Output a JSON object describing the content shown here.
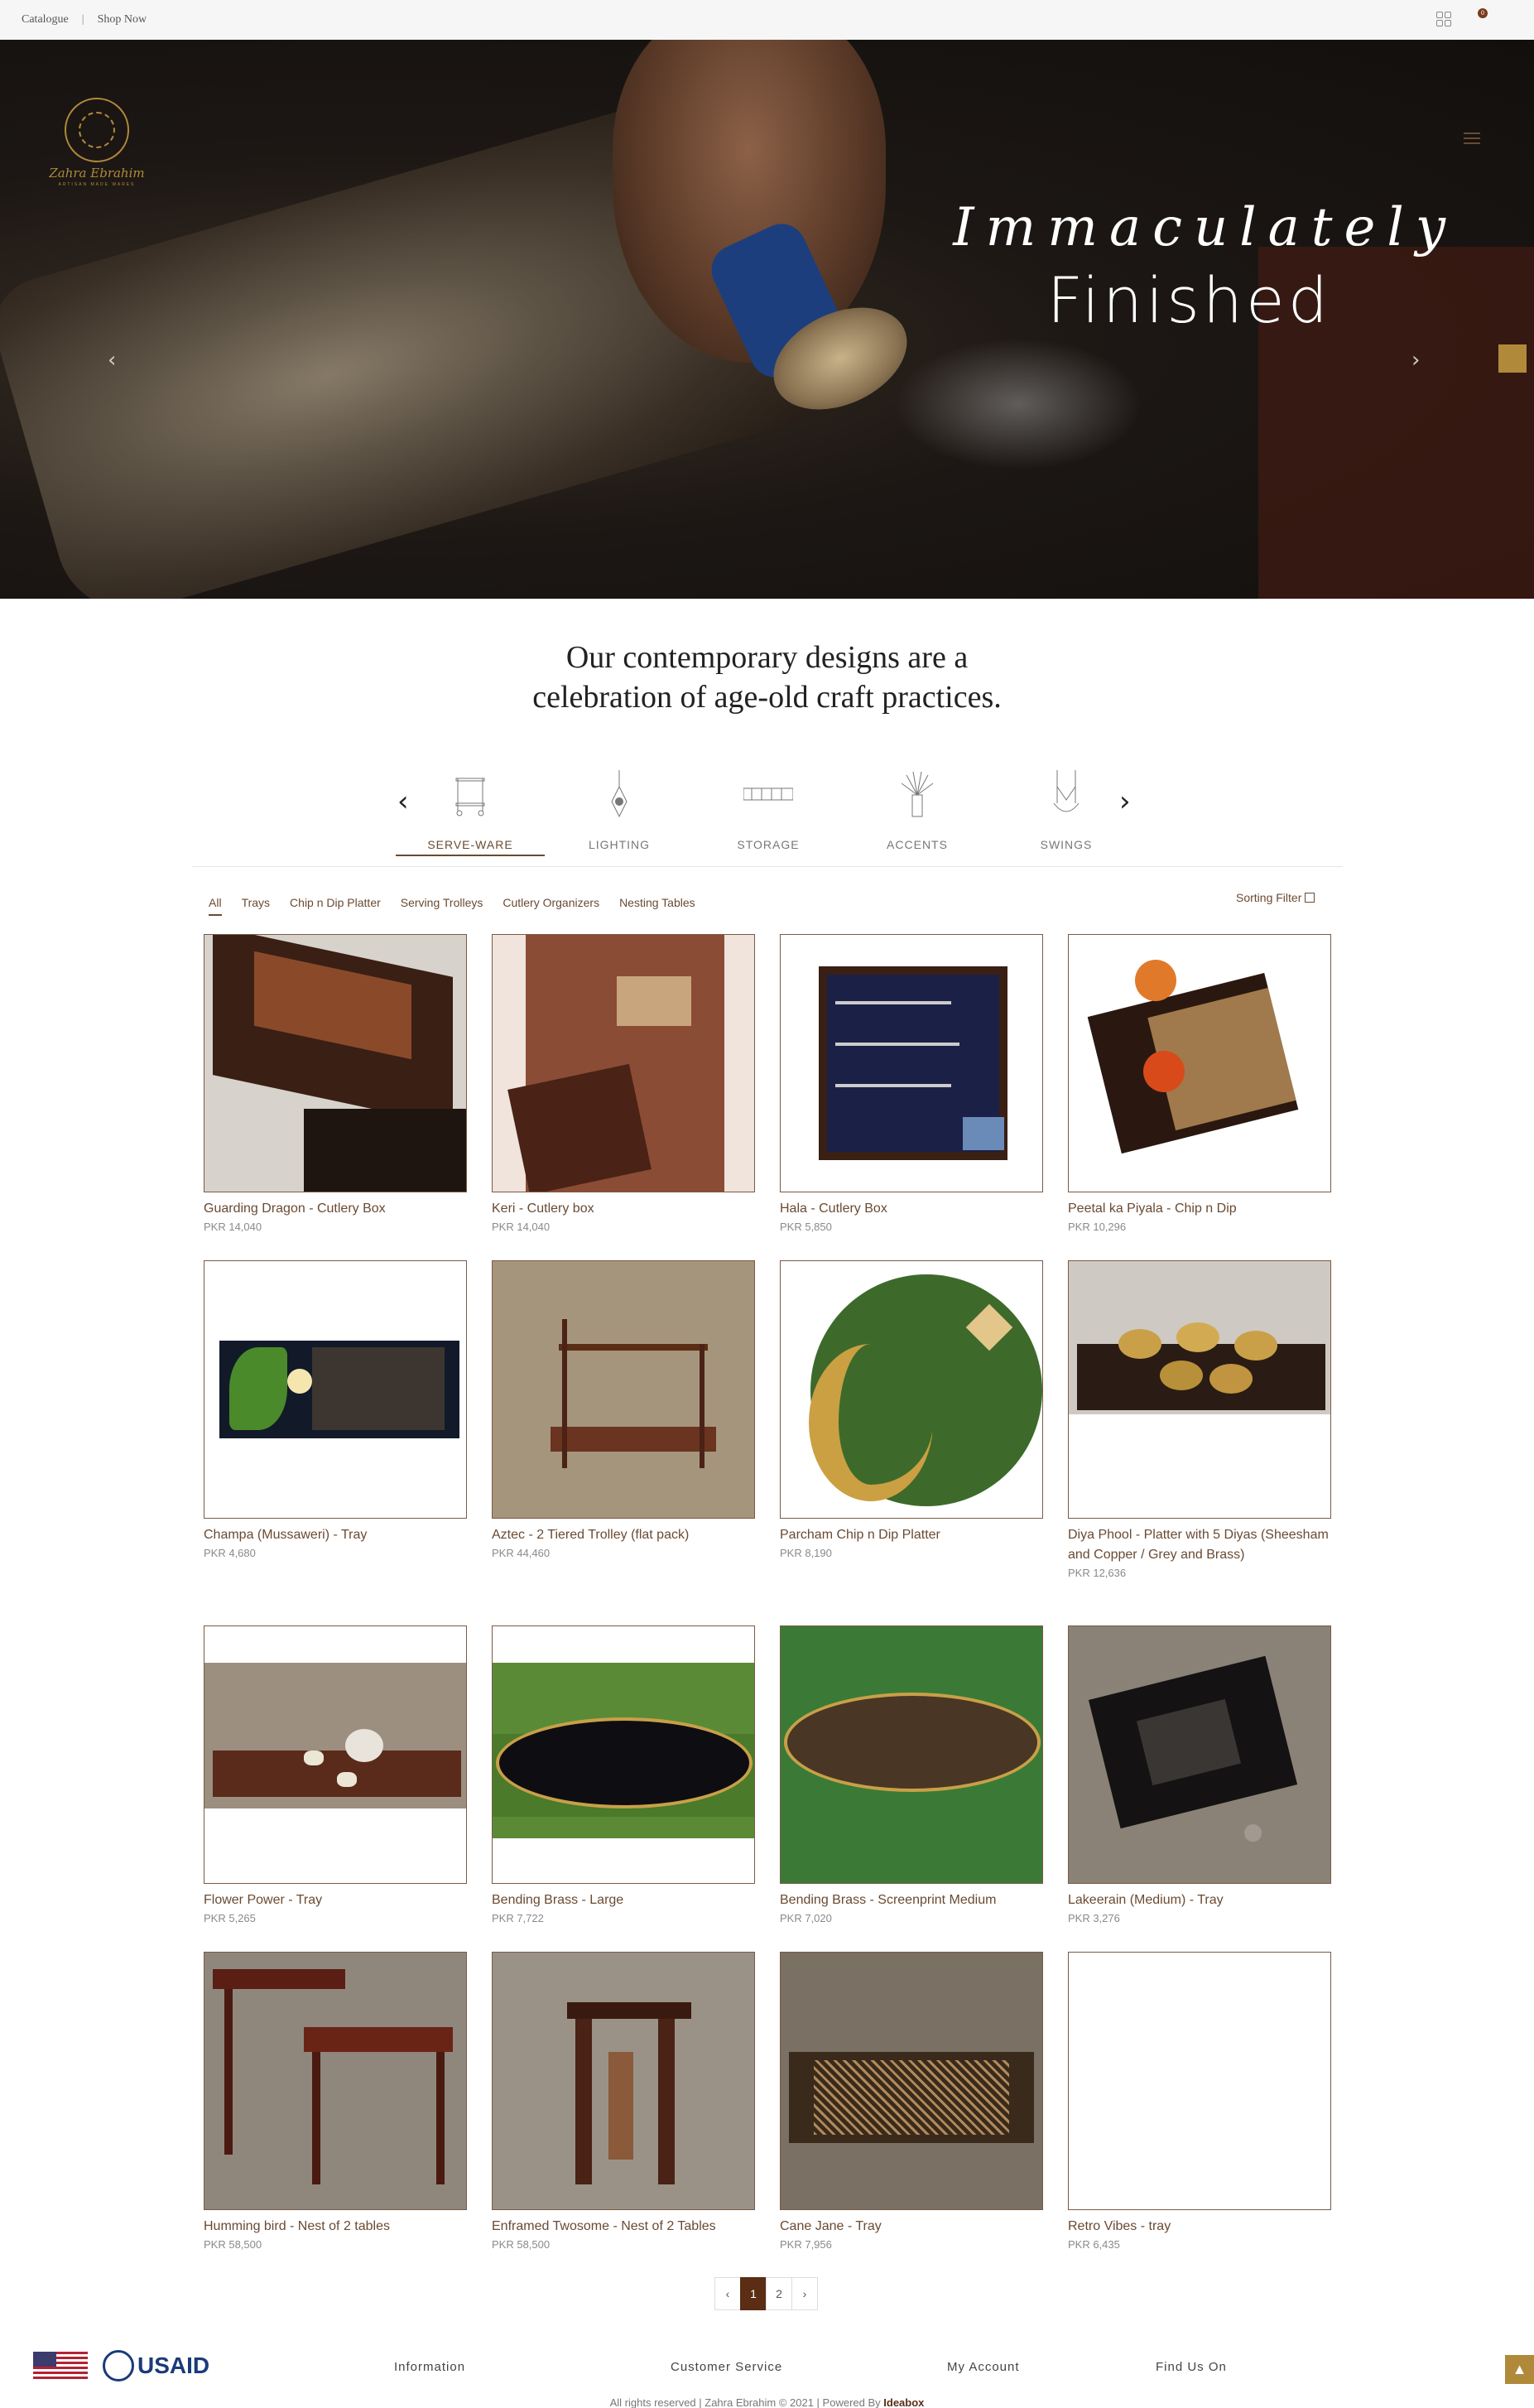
{
  "topbar": {
    "catalogue": "Catalogue",
    "shop_now": "Shop Now",
    "cart_count": "0"
  },
  "brand": {
    "name": "Zahra Ebrahim",
    "tagline": "ARTISAN MADE WARES"
  },
  "hero": {
    "script": "Immaculately",
    "title": "Finished",
    "slides": 4,
    "active_slide": 1
  },
  "intro": {
    "line1": "Our contemporary designs are a",
    "line2": "celebration of age-old craft practices."
  },
  "categories": [
    {
      "label": "SERVE-WARE",
      "icon": "trolley-icon"
    },
    {
      "label": "LIGHTING",
      "icon": "lamp-icon"
    },
    {
      "label": "STORAGE",
      "icon": "storage-icon"
    },
    {
      "label": "ACCENTS",
      "icon": "plant-icon"
    },
    {
      "label": "SWINGS",
      "icon": "swing-icon"
    }
  ],
  "filters": [
    "All",
    "Trays",
    "Chip n Dip Platter",
    "Serving Trolleys",
    "Cutlery Organizers",
    "Nesting Tables"
  ],
  "sort_label": "Sorting Filter",
  "products": [
    {
      "title": "Guarding Dragon - Cutlery Box",
      "price": "PKR 14,040"
    },
    {
      "title": "Keri - Cutlery box",
      "price": "PKR 14,040"
    },
    {
      "title": "Hala - Cutlery Box",
      "price": "PKR 5,850"
    },
    {
      "title": "Peetal ka Piyala - Chip n Dip",
      "price": "PKR 10,296"
    },
    {
      "title": "Champa (Mussaweri) - Tray",
      "price": "PKR 4,680"
    },
    {
      "title": "Aztec - 2 Tiered Trolley (flat pack)",
      "price": "PKR 44,460"
    },
    {
      "title": "Parcham Chip n Dip Platter",
      "price": "PKR 8,190"
    },
    {
      "title": "Diya Phool - Platter with 5 Diyas (Sheesham and Copper / Grey and Brass)",
      "price": "PKR 12,636"
    },
    {
      "title": "Flower Power - Tray",
      "price": "PKR 5,265"
    },
    {
      "title": "Bending Brass - Large",
      "price": "PKR 7,722"
    },
    {
      "title": "Bending Brass - Screenprint Medium",
      "price": "PKR 7,020"
    },
    {
      "title": "Lakeerain (Medium) - Tray",
      "price": "PKR 3,276"
    },
    {
      "title": "Humming bird - Nest of 2 tables",
      "price": "PKR 58,500"
    },
    {
      "title": "Enframed Twosome - Nest of 2 Tables",
      "price": "PKR 58,500"
    },
    {
      "title": "Cane Jane - Tray",
      "price": "PKR 7,956"
    },
    {
      "title": "Retro Vibes - tray",
      "price": "PKR 6,435"
    }
  ],
  "pagination": {
    "prev": "‹",
    "pages": [
      "1",
      "2"
    ],
    "next": "›",
    "current": "1"
  },
  "footer": {
    "usaid": "USAID",
    "columns": [
      "Information",
      "Customer Service",
      "My Account",
      "Find Us On"
    ],
    "copyright_prefix": "All rights reserved | Zahra Ebrahim © 2021 | Powered By ",
    "powered_by": "Ideabox"
  },
  "colors": {
    "accent": "#b08a3a",
    "brand_brown": "#5a2d14",
    "text_brown": "#6a4a32"
  }
}
